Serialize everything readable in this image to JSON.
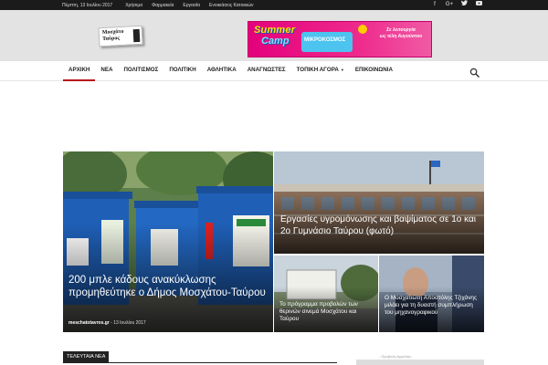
{
  "topbar": {
    "date": "Πέμπτη, 13 Ιουλίου 2017",
    "links": [
      "Χρήσιμα",
      "Φαρμακεία",
      "Εργασία",
      "Ενοικιάσεις Κατοικιών"
    ],
    "social_icons": [
      "facebook-icon",
      "google-plus-icon",
      "twitter-icon",
      "youtube-icon"
    ]
  },
  "header": {
    "logo_line1": "Μοσχάτο",
    "logo_line2": "Ταύρος"
  },
  "banner": {
    "word1": "Summer",
    "word2": "Camp",
    "kids": "ΜΙΚΡΟΚΟΣΜΟΣ",
    "info_line1": "Σε λειτουργία",
    "info_line2": "ως τέλη Αυγούστου"
  },
  "nav": {
    "items": [
      "ΑΡΧΙΚΗ",
      "ΝΕΑ",
      "ΠΟΛΙΤΙΣΜΟΣ",
      "ΠΟΛΙΤΙΚΗ",
      "ΑΘΛΗΤΙΚΑ",
      "ΑΝΑΓΝΩΣΤΕΣ",
      "ΤΟΠΙΚΗ ΑΓΟΡΑ",
      "ΕΠΙΚΟΙΝΩΝΙΑ"
    ],
    "active_index": 0,
    "search_icon": "search-icon"
  },
  "featured": {
    "main": {
      "title": "200 μπλε κάδους ανακύκλωσης προμηθεύτηκε ο Δήμος Μοσχάτου-Ταύρου",
      "author": "meschatotavros.gr",
      "date": "13 Ιουλίου 2017"
    },
    "right": {
      "title": "Εργασίες υγρομόνωσης και βαψίματος σε 1ο και 2ο Γυμνάσιο Ταύρου (φωτό)"
    },
    "small1": {
      "title": "Το πρόγραμμα προβολών των θερινών σινεμά Μοσχάτου και Ταύρου"
    },
    "small2": {
      "title": "Ο Μοσχατιώτη Αποστόλης Τζιχάνης μιλάει για τη δυαστή συμπλήρωση του μηχανογραφικού"
    }
  },
  "latest": {
    "label": "ΤΕΛΕΥΤΑΙΑ ΝΕΑ"
  },
  "ad": {
    "label": "- Προβολή Αγγελίας -"
  },
  "colors": {
    "accent": "#b5151b",
    "topbar": "#1b1b1b",
    "header": "#e3e3e3"
  }
}
